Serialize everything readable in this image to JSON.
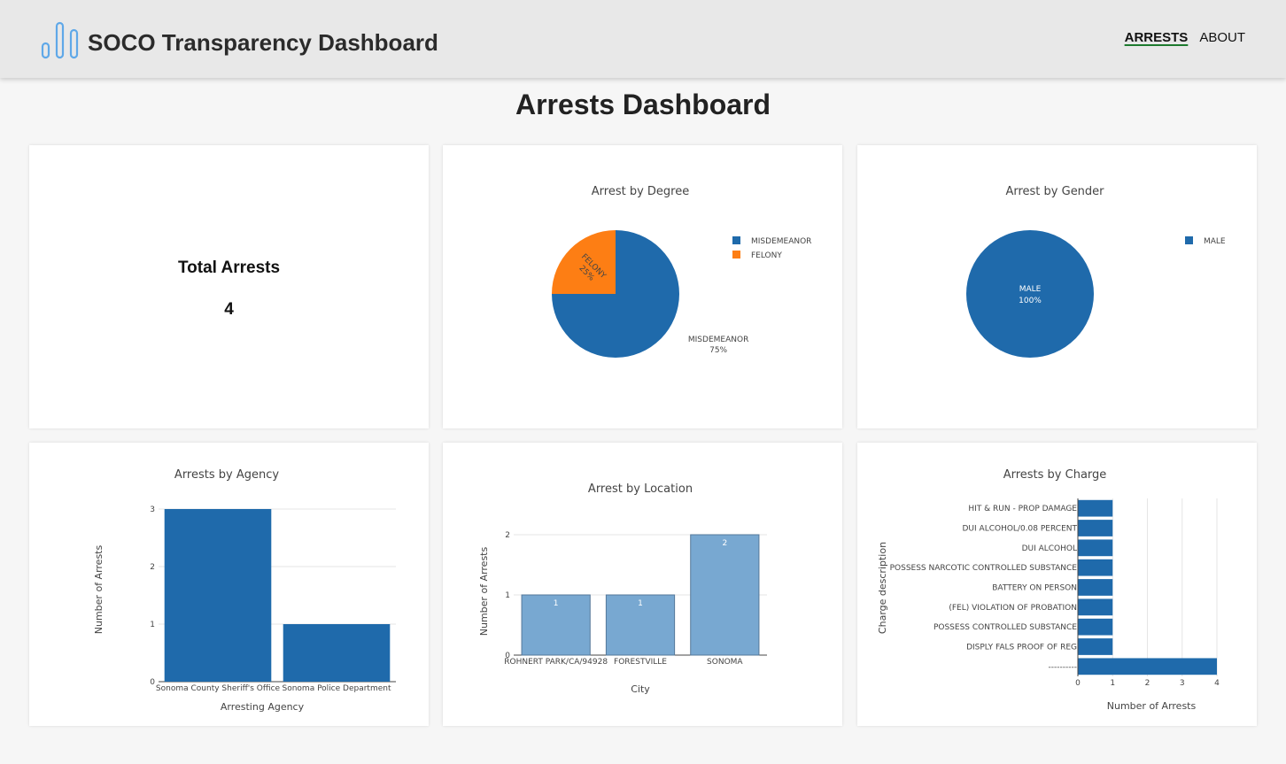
{
  "app": {
    "title": "SOCO Transparency Dashboard",
    "logo_icon": "bar-chart-logo-icon"
  },
  "nav": {
    "items": [
      {
        "label": "ARRESTS",
        "active": true
      },
      {
        "label": "ABOUT",
        "active": false
      }
    ]
  },
  "page": {
    "title": "Arrests Dashboard"
  },
  "total": {
    "label": "Total Arrests",
    "value": "4"
  },
  "colors": {
    "blue": "#1f6aab",
    "orange": "#fd7e14",
    "light_blue": "#78a8d1"
  },
  "chart_data": [
    {
      "id": "degree",
      "type": "pie",
      "title": "Arrest by Degree",
      "slices": [
        {
          "label": "MISDEMEANOR",
          "value": 3,
          "pct": "75%"
        },
        {
          "label": "FELONY",
          "value": 1,
          "pct": "25%"
        }
      ],
      "legend": "top-right"
    },
    {
      "id": "gender",
      "type": "pie",
      "title": "Arrest by Gender",
      "slices": [
        {
          "label": "MALE",
          "value": 4,
          "pct": "100%"
        }
      ],
      "legend": "top-right"
    },
    {
      "id": "agency",
      "type": "bar",
      "title": "Arrests by Agency",
      "categories": [
        "Sonoma County Sheriff's Office",
        "Sonoma Police Department"
      ],
      "values": [
        3,
        1
      ],
      "xlabel": "Arresting Agency",
      "ylabel": "Number of Arrests",
      "ylim": [
        0,
        3
      ],
      "yticks": [
        0,
        1,
        2,
        3
      ],
      "grid": true
    },
    {
      "id": "location",
      "type": "bar",
      "title": "Arrest by Location",
      "categories": [
        "ROHNERT PARK/CA/94928",
        "FORESTVILLE",
        "SONOMA"
      ],
      "values": [
        1,
        1,
        2
      ],
      "xlabel": "City",
      "ylabel": "Number of Arrests",
      "ylim": [
        0,
        2
      ],
      "yticks": [
        0,
        1,
        2
      ],
      "data_labels": true,
      "grid": true
    },
    {
      "id": "charge",
      "type": "bar",
      "orientation": "horizontal",
      "title": "Arrests by Charge",
      "categories": [
        "HIT & RUN - PROP DAMAGE",
        "DUI ALCOHOL/0.08 PERCENT",
        "DUI ALCOHOL",
        "POSSESS NARCOTIC CONTROLLED SUBSTANCE",
        "BATTERY ON PERSON",
        "(FEL) VIOLATION OF PROBATION",
        "POSSESS CONTROLLED SUBSTANCE",
        "DISPLY FALS PROOF OF REG",
        "----------"
      ],
      "values": [
        1,
        1,
        1,
        1,
        1,
        1,
        1,
        1,
        4
      ],
      "xlabel": "Number of Arrests",
      "ylabel": "Charge description",
      "xlim": [
        0,
        4
      ],
      "xticks": [
        0,
        1,
        2,
        3,
        4
      ],
      "grid": true
    }
  ]
}
